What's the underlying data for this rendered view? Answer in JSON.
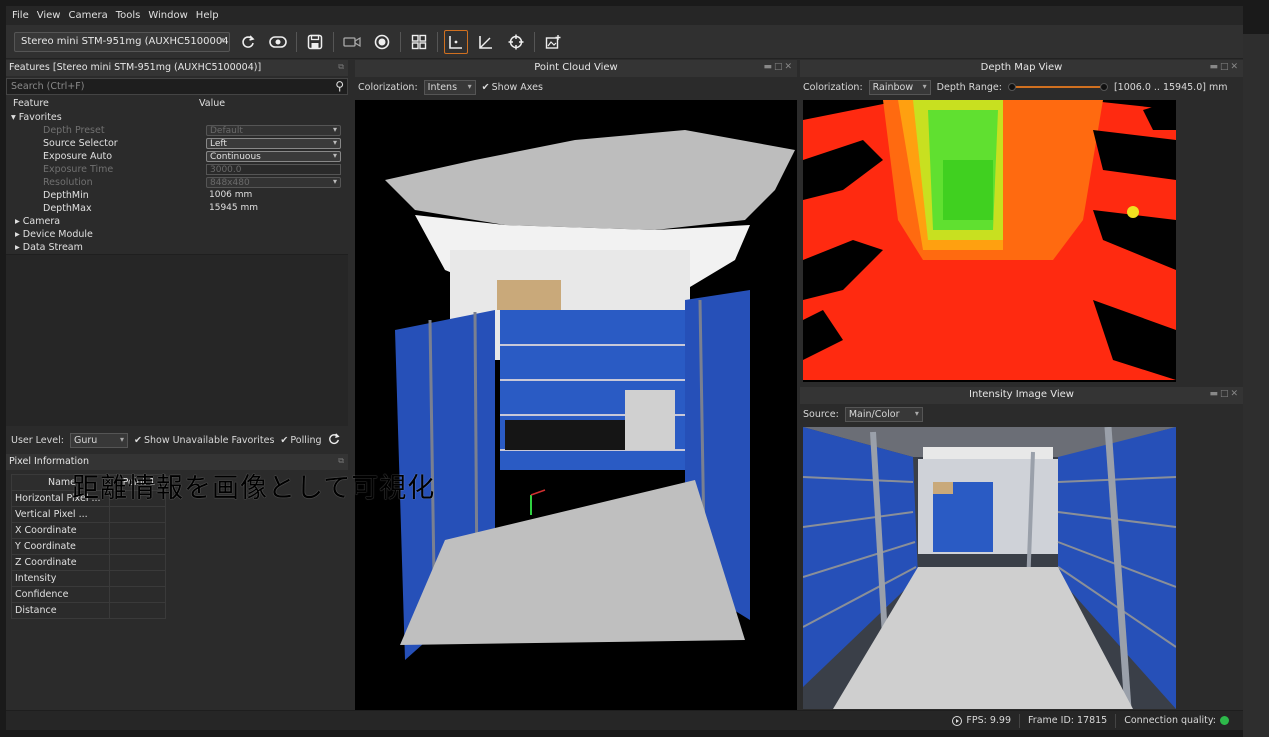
{
  "menu": [
    "File",
    "View",
    "Camera",
    "Tools",
    "Window",
    "Help"
  ],
  "toolbar": {
    "device": "Stereo mini STM-951mg (AUXHC5100004)",
    "buttons": [
      "refresh-icon",
      "eye-icon",
      "save-icon",
      "video-record-icon",
      "record-icon",
      "grid-icon",
      "pointcloud-icon",
      "axes-icon",
      "crosshair-icon",
      "snapshot-icon"
    ]
  },
  "features": {
    "title": "Features [Stereo mini STM-951mg (AUXHC5100004)]",
    "search_placeholder": "Search (Ctrl+F)",
    "col_feature": "Feature",
    "col_value": "Value",
    "favorites": "Favorites",
    "rows": [
      {
        "label": "Depth Preset",
        "value": "Default",
        "kind": "combo",
        "disabled": true
      },
      {
        "label": "Source Selector",
        "value": "Left",
        "kind": "combo",
        "disabled": false
      },
      {
        "label": "Exposure Auto",
        "value": "Continuous",
        "kind": "combo",
        "disabled": false
      },
      {
        "label": "Exposure Time",
        "value": "3000.0",
        "kind": "edit",
        "disabled": true
      },
      {
        "label": "Resolution",
        "value": "848x480",
        "kind": "combo",
        "disabled": true
      },
      {
        "label": "DepthMin",
        "value": "1006 mm",
        "kind": "text",
        "disabled": false
      },
      {
        "label": "DepthMax",
        "value": "15945 mm",
        "kind": "text",
        "disabled": false
      }
    ],
    "groups": [
      "Camera",
      "Device Module",
      "Data Stream"
    ]
  },
  "user_level": {
    "label": "User Level:",
    "value": "Guru",
    "show_unavailable": "Show Unavailable Favorites",
    "polling": "Polling"
  },
  "pixel_info": {
    "title": "Pixel Information",
    "col_name": "Name",
    "col_point": "Point 1",
    "rows": [
      "Horizontal Pixel ...",
      "Vertical Pixel ...",
      "X Coordinate",
      "Y Coordinate",
      "Z Coordinate",
      "Intensity",
      "Confidence",
      "Distance"
    ]
  },
  "overlay_text": "距離情報を画像として可視化",
  "point_cloud": {
    "title": "Point Cloud View",
    "colorization_label": "Colorization:",
    "colorization_value": "Intens",
    "show_axes": "Show Axes"
  },
  "depth_map": {
    "title": "Depth Map View",
    "colorization_label": "Colorization:",
    "colorization_value": "Rainbow",
    "range_label": "Depth Range:",
    "range_value": "[1006.0 .. 15945.0] mm",
    "range_min": 1006.0,
    "range_max": 15945.0
  },
  "intensity": {
    "title": "Intensity Image View",
    "source_label": "Source:",
    "source_value": "Main/Color"
  },
  "status": {
    "fps": "FPS: 9.99",
    "frame_id": "Frame ID: 17815",
    "connection": "Connection quality:"
  },
  "colors": {
    "accent": "#d07020",
    "ok": "#2db84a",
    "shelf_blue": "#2a5bc4"
  }
}
